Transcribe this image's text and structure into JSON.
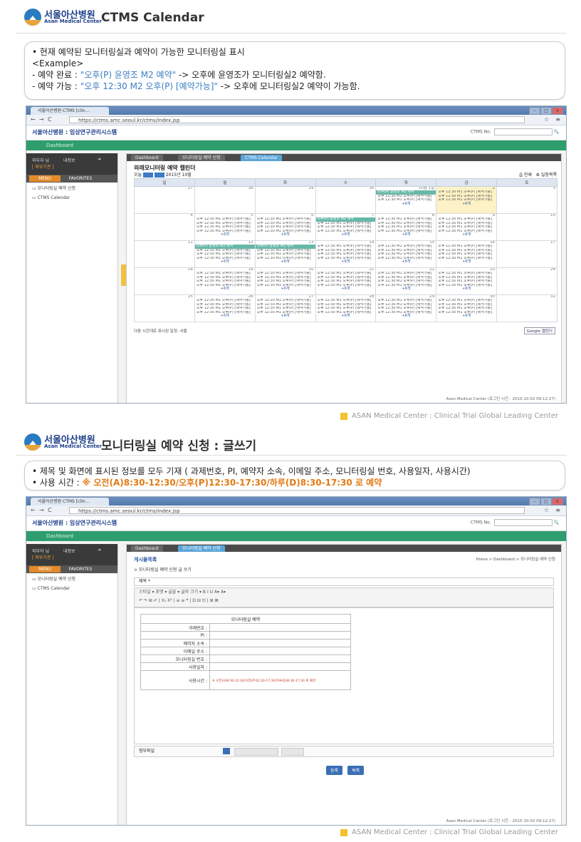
{
  "section1": {
    "logo_kr": "서울아산병원",
    "logo_en": "Asan Medical Center",
    "title": "CTMS Calendar",
    "lines": {
      "l1": "• 현재 예약된 모니터링실과 예약이 가능한 모니터링실 표시",
      "l2": "<Example>",
      "l3a": "- 예약 완료 : ",
      "l3b": "\"오후(P) 윤영조 M2 예약\"",
      "l3c": " -> 오후에 윤영조가 모니터링실2 예약함.",
      "l4a": "- 예약 가능 : ",
      "l4b": "\"오후 12:30 M2 오후(P) [예약가능]\"",
      "l4c": " -> 오후에 모니터링실2 예약이 가능함."
    }
  },
  "browser1": {
    "tab": "서울아산병원 CTMS [clin...",
    "url": "https://ctms.amc.seoul.kr/ctms/index.jsp",
    "app_logo": "서울아산병원 : 임상연구관리시스템",
    "ctms_no": "CTMS No.",
    "dashboard": "Dashboard",
    "user1": "외부자 님",
    "user2": "내정보",
    "user3": "[ 외부기관 ]",
    "menu": "MENU",
    "favorites": "FAVORITES",
    "left_items": [
      "모니터링실 예약 신청",
      "CTMS Calendar"
    ],
    "tabs": [
      "Dashboard",
      "모니터링실 예약 신청",
      "CTMS Calendar"
    ],
    "cal_title": "외래모니터링 예약 캘린더",
    "cal_month": "2015년 10월",
    "cal_today": "오늘",
    "cal_print": "인쇄",
    "cal_views": "일정목록",
    "weekdays": [
      "일",
      "월",
      "화",
      "수",
      "목",
      "금",
      "토"
    ],
    "event_generic": "오후 12:30 M1 오후(P) [예약가능]",
    "event_more": "+6개",
    "event_reserved": "오후(P) 윤영조 M2 예약",
    "weeks": [
      [
        "27",
        "28",
        "29",
        "30",
        "10월 1일",
        "2",
        "3"
      ],
      [
        "4",
        "5",
        "6",
        "7",
        "8",
        "9",
        "10"
      ],
      [
        "11",
        "12",
        "13",
        "14",
        "15",
        "16",
        "17"
      ],
      [
        "18",
        "19",
        "20",
        "21",
        "22",
        "23",
        "24"
      ],
      [
        "25",
        "26",
        "27",
        "28",
        "29",
        "30",
        "31"
      ]
    ],
    "cal_footer": "다음 시간대로 표시된 일정: 서울",
    "gcal": "Google 캘린더",
    "footer": "Asan Medical Center (로그인 시간 : 2015-10-02 09:12:27)"
  },
  "bottom_banner": "ASAN Medical Center : Clinical Trial Global Leading Center",
  "section2": {
    "title": "모니터링실 예약 신청 : 글쓰기",
    "l1": "• 제목 및 화면에 표시된 정보를 모두 기재 ( 과제번호, PI, 예약자 소속, 이메일 주소, 모니터링실 번호, 사용일자, 사용시간)",
    "l2a": "• 사용 시간 : ",
    "l2b": "※ 오전(A)8:30-12:30/오후(P)12:30-17:30/하루(D)8:30-17:30 로 예약"
  },
  "browser2": {
    "tabs": [
      "Dashboard",
      "모니터링실 예약 신청"
    ],
    "board_title": "게시물목록",
    "crumb": "Home > Dashboard > 모니터링실 예약 신청",
    "sub": "> 모니터링실 예약 신청 글 쓰기",
    "subject_label": "제목 *",
    "tb_row1": "스타일   ▾   포맷   ▾   글꼴   ▾   글자 크기   ▾   B  I  U  A▾  A▾",
    "tb_row2": "↶  ↷  ⊞  ✐  |  X₂  X²  |  ≡  ≡  ❝  |  Ω  ⊟  ⊡  |  ⊞  ⊠",
    "form_header": "모니터링실 예약",
    "form_labels": [
      "과제번호 :",
      "PI :",
      "예약자 소속 :",
      "이메일 주소 :",
      "모니터링실 번호 :",
      "사용일자 :",
      "사용시간 :"
    ],
    "time_hint": "※ 오전(A)8:30-12:30/오후(P)12:30-17:30/하루(D)8:30-17:30 로 예약",
    "attach_label": "첨부파일",
    "btn_save": "등록",
    "btn_list": "목록",
    "footer": "Asan Medical Center (로그인 시간 : 2015-10-02 09:12:27)"
  },
  "colors": {
    "green": "#2f9e6e",
    "blue": "#3a7ec2",
    "orange": "#e37a15",
    "gold": "#f3c22e"
  }
}
